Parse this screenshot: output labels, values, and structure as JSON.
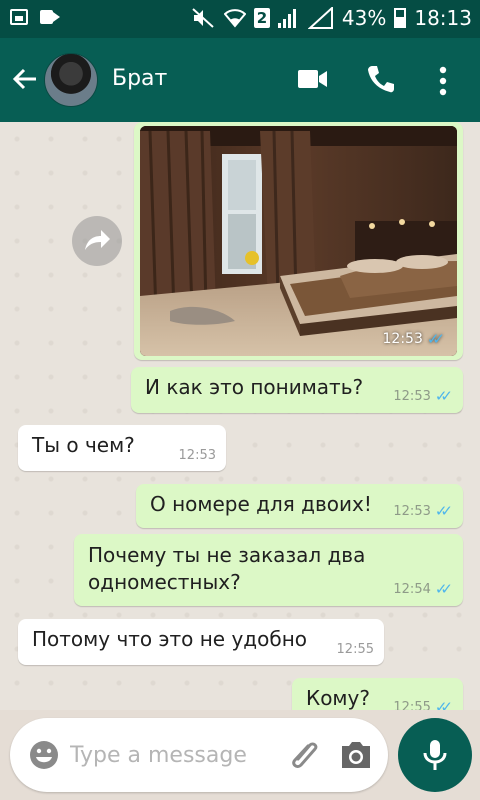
{
  "status_bar": {
    "battery": "43%",
    "time": "18:13",
    "sim": "2"
  },
  "header": {
    "contact_name": "Брат"
  },
  "messages": [
    {
      "text": "И как это понимать?",
      "time": "12:53"
    },
    {
      "text": "Ты о чем?",
      "time": "12:53"
    },
    {
      "text": "О номере для двоих!",
      "time": "12:53"
    },
    {
      "line1": "Почему ты не заказал два",
      "line2": "одноместных?",
      "time": "12:54"
    },
    {
      "text": "Потому что это не удобно",
      "time": "12:55"
    },
    {
      "text": "Кому?",
      "time": "12:55"
    }
  ],
  "image_message": {
    "time": "12:53"
  },
  "composer": {
    "placeholder": "Type a message"
  },
  "colors": {
    "header": "#075e54",
    "status_bar": "#054d44",
    "outgoing_bubble": "#dcf8c6",
    "incoming_bubble": "#ffffff",
    "read_ticks": "#4fb6ec"
  }
}
